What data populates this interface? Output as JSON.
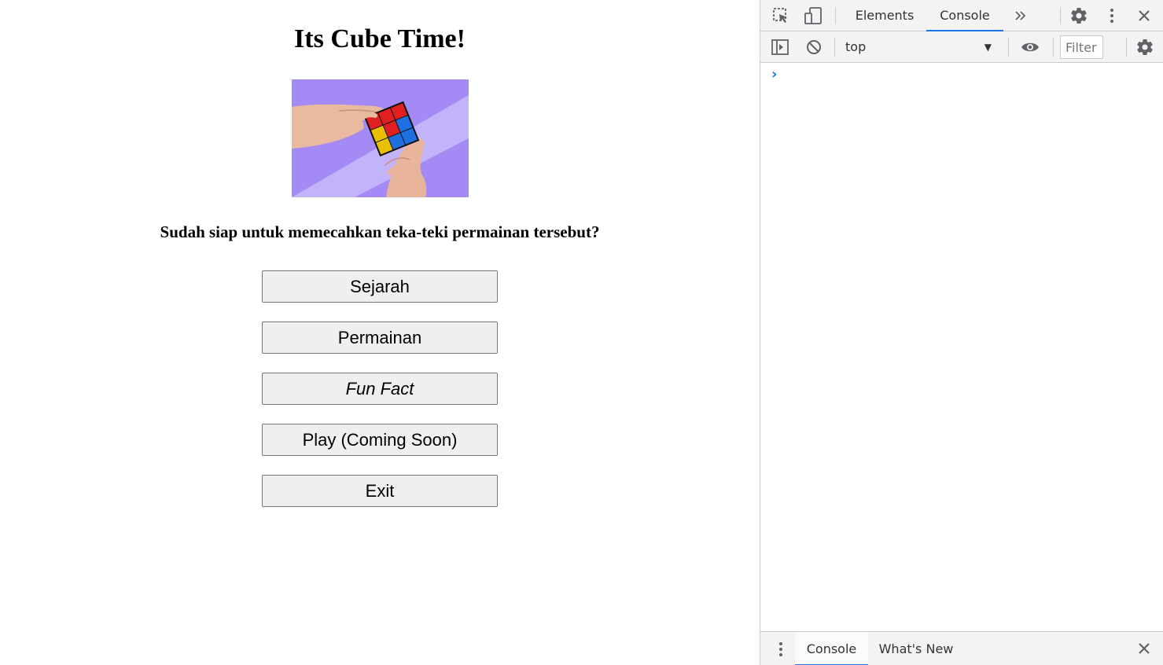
{
  "page": {
    "title": "Its Cube Time!",
    "subtitle": "Sudah siap untuk memecahkan teka-teki permainan tersebut?",
    "hero_image": "hands-solving-rubiks-cube",
    "buttons": [
      {
        "label": "Sejarah"
      },
      {
        "label": "Permainan"
      },
      {
        "label": "Fun Fact"
      },
      {
        "label": "Play (Coming Soon)"
      },
      {
        "label": "Exit"
      }
    ]
  },
  "devtools": {
    "tabs": [
      {
        "label": "Elements",
        "active": false
      },
      {
        "label": "Console",
        "active": true
      }
    ],
    "toolbar": {
      "context": "top",
      "filter_placeholder": "Filter"
    },
    "console": {
      "prompt": "›"
    },
    "drawer": {
      "tabs": [
        {
          "label": "Console",
          "active": true
        },
        {
          "label": "What's New",
          "active": false
        }
      ]
    },
    "icons": [
      "inspect-element-icon",
      "device-toolbar-icon",
      "more-tabs-icon",
      "settings-icon",
      "kebab-menu-icon",
      "close-icon",
      "sidebar-toggle-icon",
      "clear-console-icon",
      "eye-icon",
      "console-settings-icon",
      "drawer-menu-icon",
      "drawer-close-icon"
    ],
    "accent_color": "#1a73e8"
  }
}
